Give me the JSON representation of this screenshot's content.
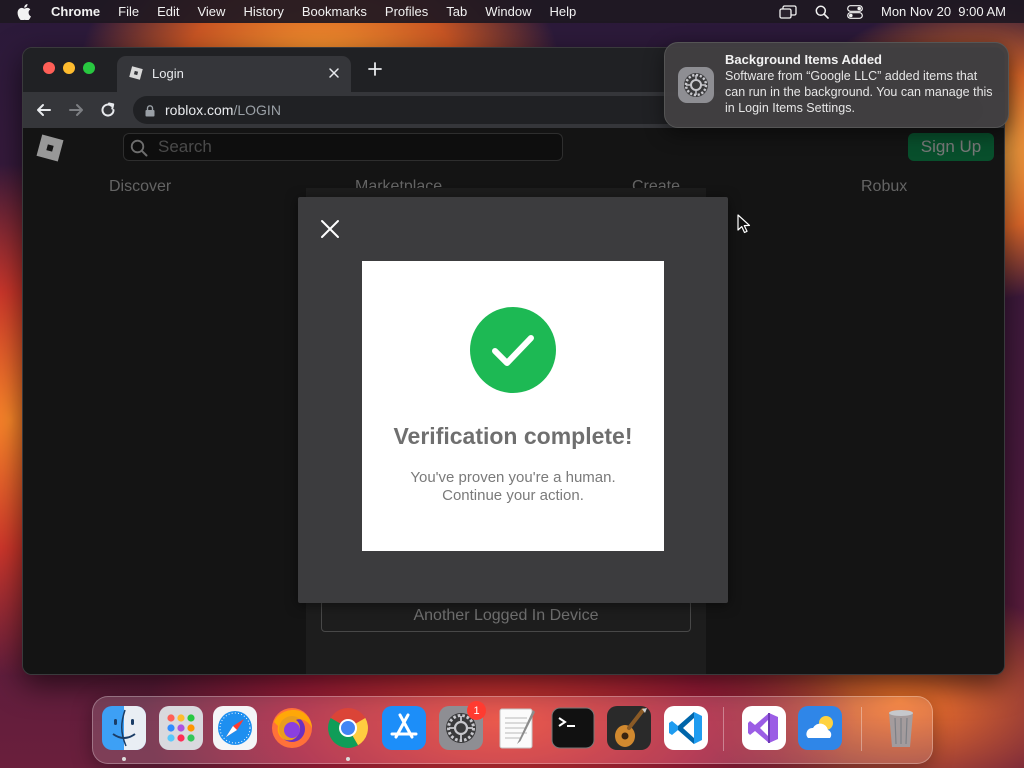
{
  "menubar": {
    "app_name": "Chrome",
    "items": [
      "File",
      "Edit",
      "View",
      "History",
      "Bookmarks",
      "Profiles",
      "Tab",
      "Window",
      "Help"
    ],
    "datetime": "Mon Nov 20  9:00 AM",
    "status_icons": [
      "screen-mirroring-icon",
      "spotlight-search-icon",
      "control-center-icon"
    ]
  },
  "browser": {
    "tab_title": "Login",
    "url_host": "roblox.com",
    "url_path": "/LOGIN"
  },
  "roblox": {
    "search_placeholder": "Search",
    "signup_label": "Sign Up",
    "nav": [
      "Discover",
      "Marketplace",
      "Create",
      "Robux"
    ],
    "device_button": "Another Logged In Device"
  },
  "modal": {
    "title": "Verification complete!",
    "message_line1": "You've proven you're a human.",
    "message_line2": "Continue your action."
  },
  "notification": {
    "title": "Background Items Added",
    "body": "Software from “Google LLC” added items that can run in the background. You can manage this in Login Items Settings."
  },
  "dock": {
    "apps": [
      "Finder",
      "Launchpad",
      "Safari",
      "Firefox",
      "Google Chrome",
      "App Store",
      "System Settings",
      "TextEdit",
      "Terminal",
      "GarageBand",
      "Visual Studio Code",
      "Visual Studio",
      "Weather",
      "Trash"
    ],
    "settings_badge": "1"
  },
  "colors": {
    "signup_green": "#00a152",
    "check_green": "#1db954",
    "notification_bg": "#424042"
  }
}
